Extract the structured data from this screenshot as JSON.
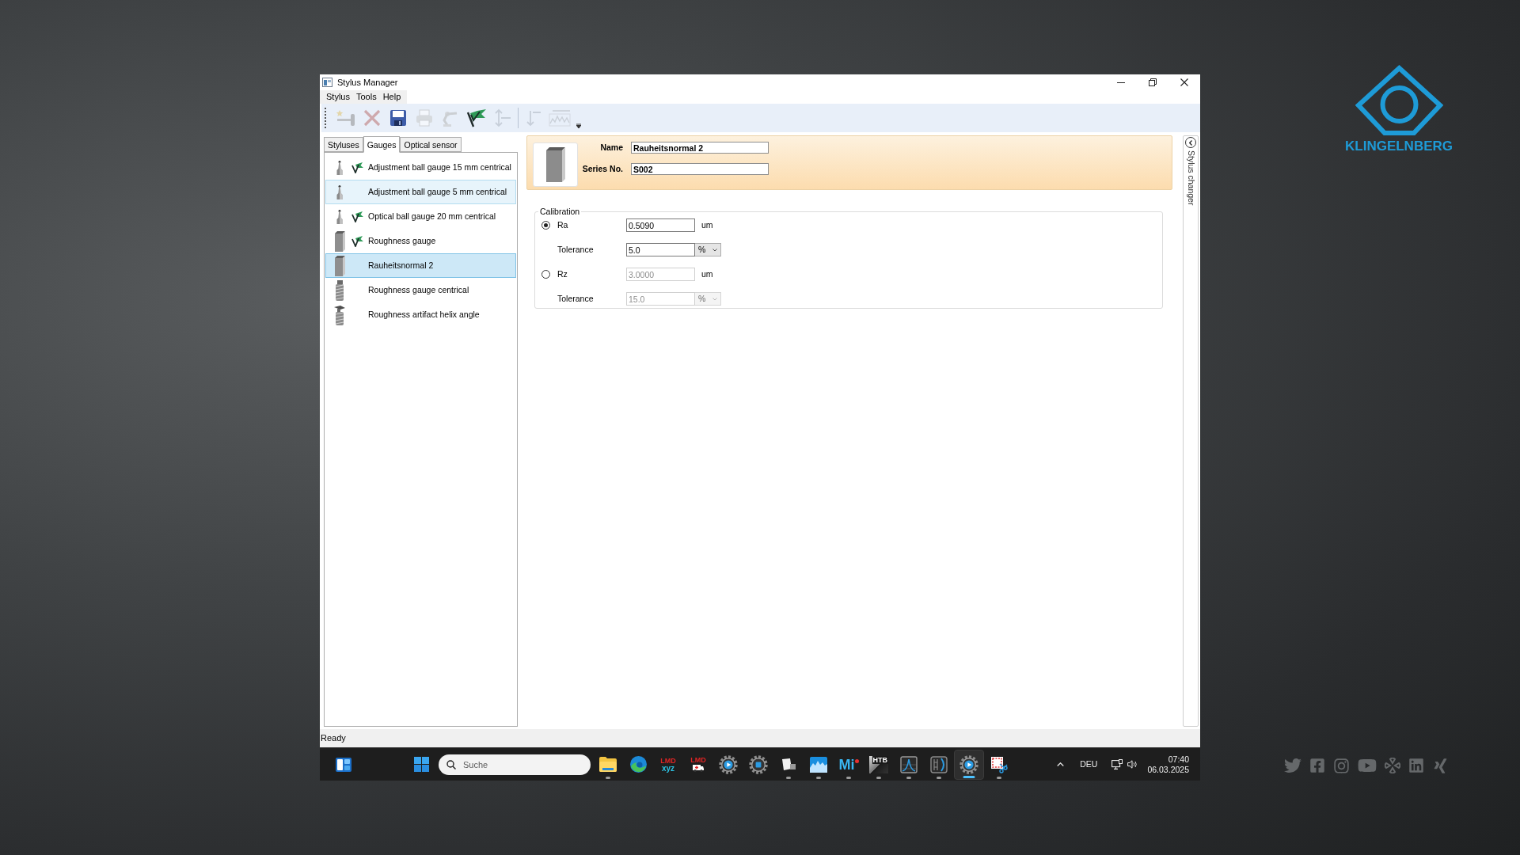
{
  "window": {
    "title": "Stylus Manager"
  },
  "menu": [
    {
      "label": "Stylus"
    },
    {
      "label": "Tools"
    },
    {
      "label": "Help"
    }
  ],
  "toolbar": [
    {
      "kind": "new-stylus",
      "disabled": true
    },
    {
      "kind": "delete",
      "disabled": true
    },
    {
      "kind": "save",
      "disabled": false
    },
    {
      "kind": "print",
      "disabled": true
    },
    {
      "kind": "calibrate",
      "disabled": true
    },
    {
      "kind": "flag",
      "disabled": false
    },
    {
      "kind": "move",
      "disabled": true
    },
    {
      "kind": "separator"
    },
    {
      "kind": "move-down",
      "disabled": true
    },
    {
      "kind": "profile",
      "disabled": true
    },
    {
      "kind": "overflow"
    }
  ],
  "tabs": [
    {
      "label": "Styluses",
      "selected": false
    },
    {
      "label": "Gauges",
      "selected": true
    },
    {
      "label": "Optical sensor",
      "selected": false
    }
  ],
  "gauges": [
    {
      "name": "Adjustment ball gauge 15 mm centrical",
      "kind": "ball",
      "calibrated": true,
      "selected": false,
      "hovered": false
    },
    {
      "name": "Adjustment ball gauge 5 mm centrical",
      "kind": "ball",
      "calibrated": false,
      "selected": false,
      "hovered": true
    },
    {
      "name": "Optical ball gauge 20 mm centrical",
      "kind": "ball",
      "calibrated": true,
      "selected": false,
      "hovered": false
    },
    {
      "name": "Roughness gauge",
      "kind": "block",
      "calibrated": true,
      "selected": false,
      "hovered": false
    },
    {
      "name": "Rauheitsnormal 2",
      "kind": "block",
      "calibrated": false,
      "selected": true,
      "hovered": false
    },
    {
      "name": "Roughness gauge centrical",
      "kind": "helix",
      "calibrated": false,
      "selected": false,
      "hovered": false
    },
    {
      "name": "Roughness artifact helix angle",
      "kind": "helix-arm",
      "calibrated": false,
      "selected": false,
      "hovered": false
    }
  ],
  "detail": {
    "name_label": "Name",
    "name": "Rauheitsnormal 2",
    "series_label": "Series No.",
    "series": "S002"
  },
  "calibration": {
    "title": "Calibration",
    "rows": [
      {
        "kind": "radio",
        "label": "Ra",
        "selected": true,
        "value": "0.5090",
        "unit": "um",
        "disabled": false
      },
      {
        "kind": "tolerance",
        "label": "Tolerance",
        "value": "5.0",
        "unit": "%",
        "disabled": false
      },
      {
        "kind": "radio",
        "label": "Rz",
        "selected": false,
        "value": "3.0000",
        "unit": "um",
        "disabled": true
      },
      {
        "kind": "tolerance",
        "label": "Tolerance",
        "value": "15.0",
        "unit": "%",
        "disabled": true
      }
    ]
  },
  "side_panel": {
    "label": "Stylus changer"
  },
  "status_bar": {
    "text": "Ready"
  },
  "taskbar": {
    "search_placeholder": "Suche",
    "apps": [
      {
        "kind": "explorer",
        "running": true,
        "selected": false
      },
      {
        "kind": "edge",
        "running": false,
        "selected": false
      },
      {
        "kind": "lmd",
        "text": "LMD",
        "subtext": "xyz",
        "running": false,
        "selected": false
      },
      {
        "kind": "lmd-ambulance",
        "text": "LMD",
        "running": false,
        "selected": false
      },
      {
        "kind": "gear-play",
        "running": false,
        "selected": false
      },
      {
        "kind": "gear-stop",
        "running": false,
        "selected": false
      },
      {
        "kind": "document",
        "running": true,
        "selected": false
      },
      {
        "kind": "wave",
        "running": true,
        "selected": false
      },
      {
        "kind": "mi",
        "text": "Mi",
        "running": true,
        "selected": false
      },
      {
        "kind": "htb",
        "text": "HTB",
        "running": true,
        "selected": false
      },
      {
        "kind": "chart",
        "running": true,
        "selected": false
      },
      {
        "kind": "film",
        "running": true,
        "selected": false
      },
      {
        "kind": "gear-play",
        "running": true,
        "selected": true
      },
      {
        "kind": "snip",
        "running": true,
        "selected": false
      }
    ],
    "language": "DEU",
    "time": "07:40",
    "date": "06.03.2025"
  },
  "branding": {
    "logo_text": "KLINGELNBERG"
  }
}
